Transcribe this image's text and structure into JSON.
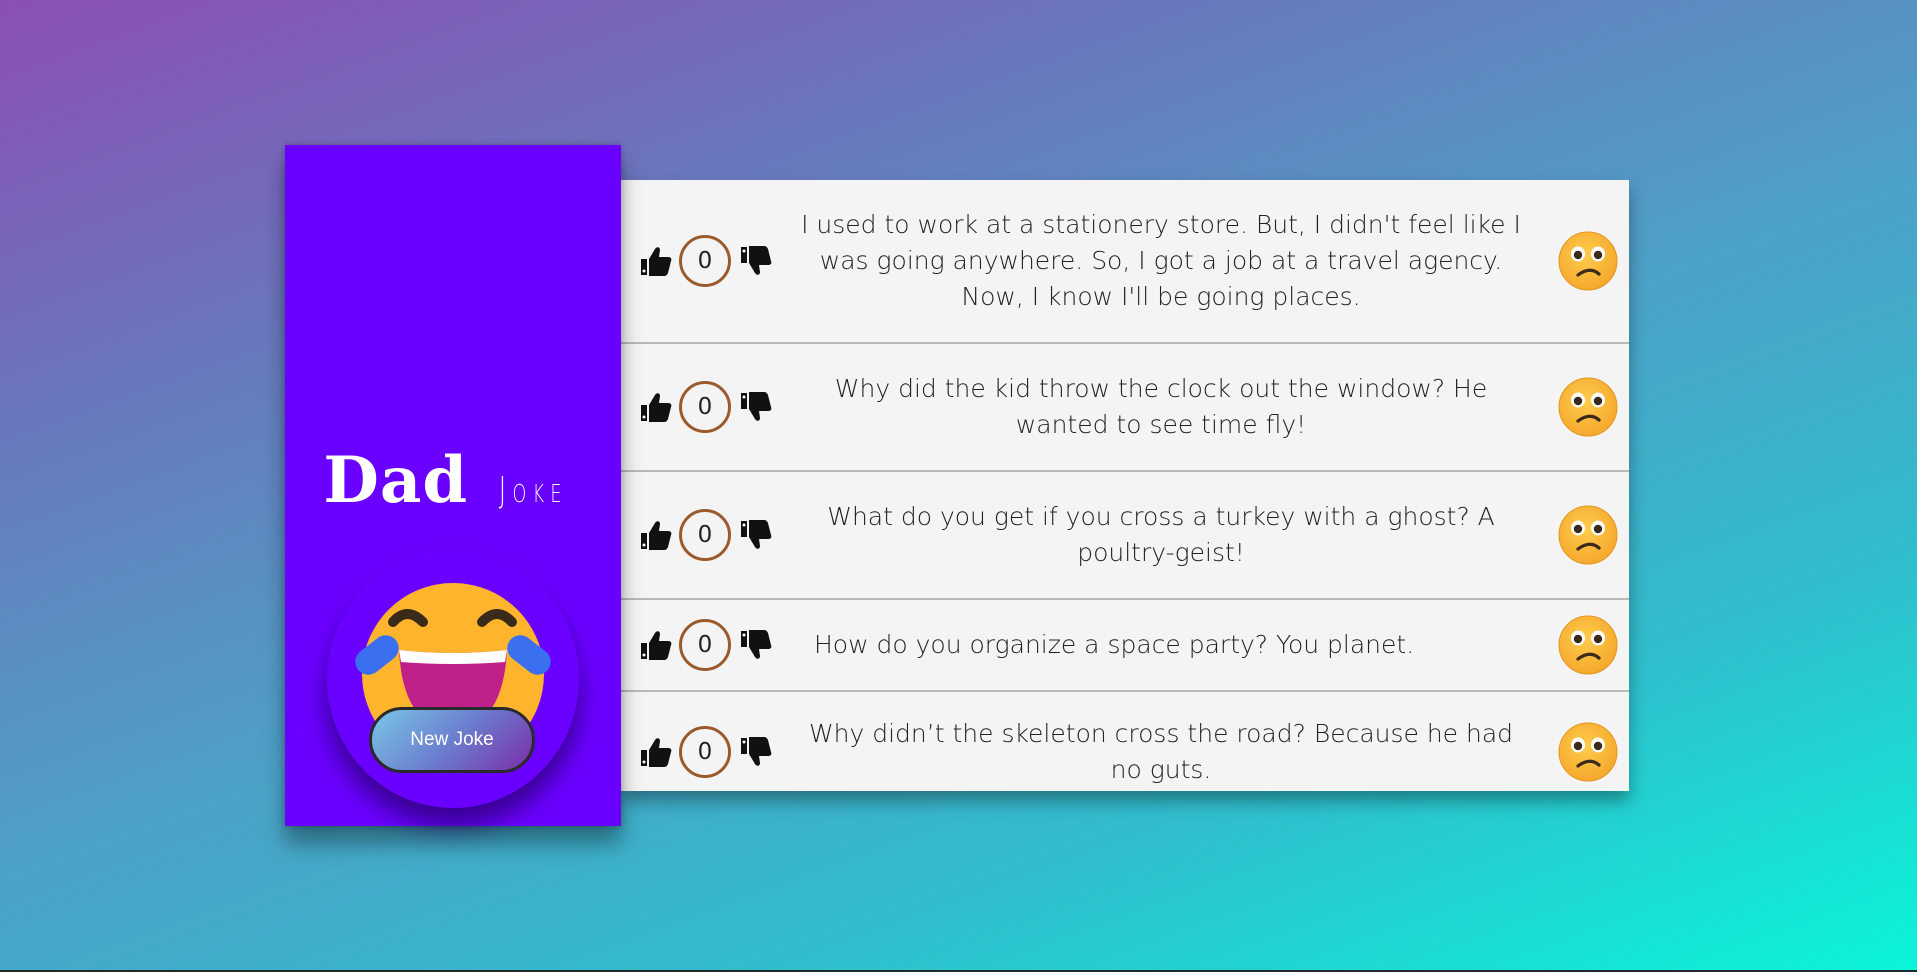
{
  "app": {
    "title_main": "Dad",
    "title_sub": "Joke",
    "new_joke_label": "New Joke",
    "colors": {
      "sidebar": "#6a00ff",
      "panel": "#f4f4f4",
      "count_border": "#9a5a2b"
    }
  },
  "jokes": [
    {
      "text": "I used to work at a stationery store. But, I didn't feel like I was going anywhere. So, I got a job at a travel agency. Now, I know I'll be going places.",
      "votes": "0",
      "face_icon": "confused-face-icon"
    },
    {
      "text": "Why did the kid throw the clock out the window? He wanted to see time fly!",
      "votes": "0",
      "face_icon": "confused-face-icon"
    },
    {
      "text": "What do you get if you cross a turkey with a ghost? A poultry-geist!",
      "votes": "0",
      "face_icon": "confused-face-icon"
    },
    {
      "text": "How do you organize a space party? You planet.",
      "votes": "0",
      "face_icon": "confused-face-icon"
    },
    {
      "text": "Why didn’t the skeleton cross the road? Because he had no guts.",
      "votes": "0",
      "face_icon": "confused-face-icon"
    }
  ]
}
